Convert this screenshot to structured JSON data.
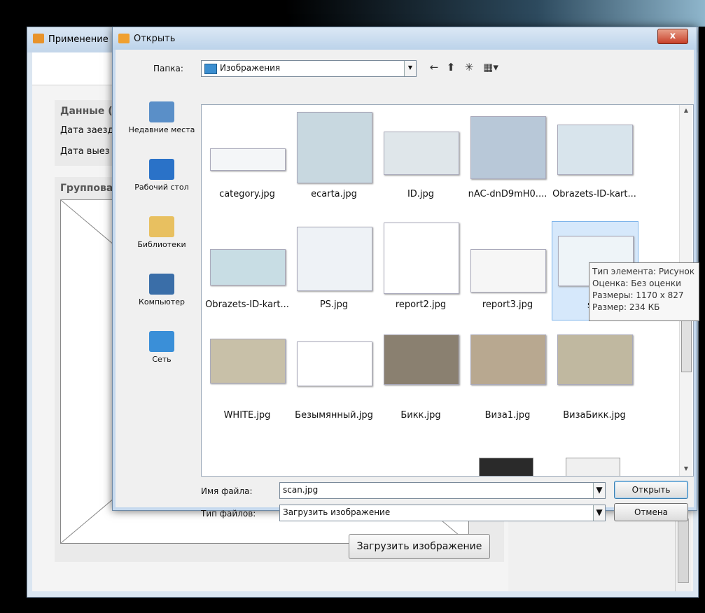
{
  "background_app": {
    "title": "Применение",
    "data_panel_header": "Данные (",
    "arrival_label": "Дата заезд",
    "departure_label": "Дата выез",
    "group_panel_header": "Группова",
    "upload_button": "Загрузить изображение"
  },
  "dialog": {
    "title": "Открыть",
    "close_label": "x",
    "folder_label": "Папка:",
    "folder_value": "Изображения",
    "places": [
      {
        "label": "Недавние места",
        "icon": "recent-places-icon",
        "color": "#5a8fc8"
      },
      {
        "label": "Рабочий стол",
        "icon": "desktop-icon",
        "color": "#2a72c8"
      },
      {
        "label": "Библиотеки",
        "icon": "libraries-icon",
        "color": "#e8c060"
      },
      {
        "label": "Компьютер",
        "icon": "computer-icon",
        "color": "#3a6ea8"
      },
      {
        "label": "Сеть",
        "icon": "network-icon",
        "color": "#3a8fd8"
      }
    ],
    "files": [
      {
        "name": "category.jpg"
      },
      {
        "name": "ecarta.jpg"
      },
      {
        "name": "ID.jpg"
      },
      {
        "name": "nAC-dnD9mH0...."
      },
      {
        "name": "Obrazets-ID-kart..."
      },
      {
        "name": "Obrazets-ID-kart..."
      },
      {
        "name": "PS.jpg"
      },
      {
        "name": "report2.jpg"
      },
      {
        "name": "report3.jpg"
      },
      {
        "name": "sca"
      },
      {
        "name": "WHITE.jpg"
      },
      {
        "name": "Безымянный.jpg"
      },
      {
        "name": "Бикк.jpg"
      },
      {
        "name": "Виза1.jpg"
      },
      {
        "name": "ВизаБикк.jpg"
      }
    ],
    "tooltip": {
      "line1": "Тип элемента: Рисунок",
      "line2": "Оценка: Без оценки",
      "line3": "Размеры: 1170 x 827",
      "line4": "Размер: 234 КБ"
    },
    "filename_label": "Имя файла:",
    "filename_value": "scan.jpg",
    "filetype_label": "Тип файлов:",
    "filetype_value": "Загрузить изображение",
    "open_button": "Открыть",
    "cancel_button": "Отмена"
  }
}
